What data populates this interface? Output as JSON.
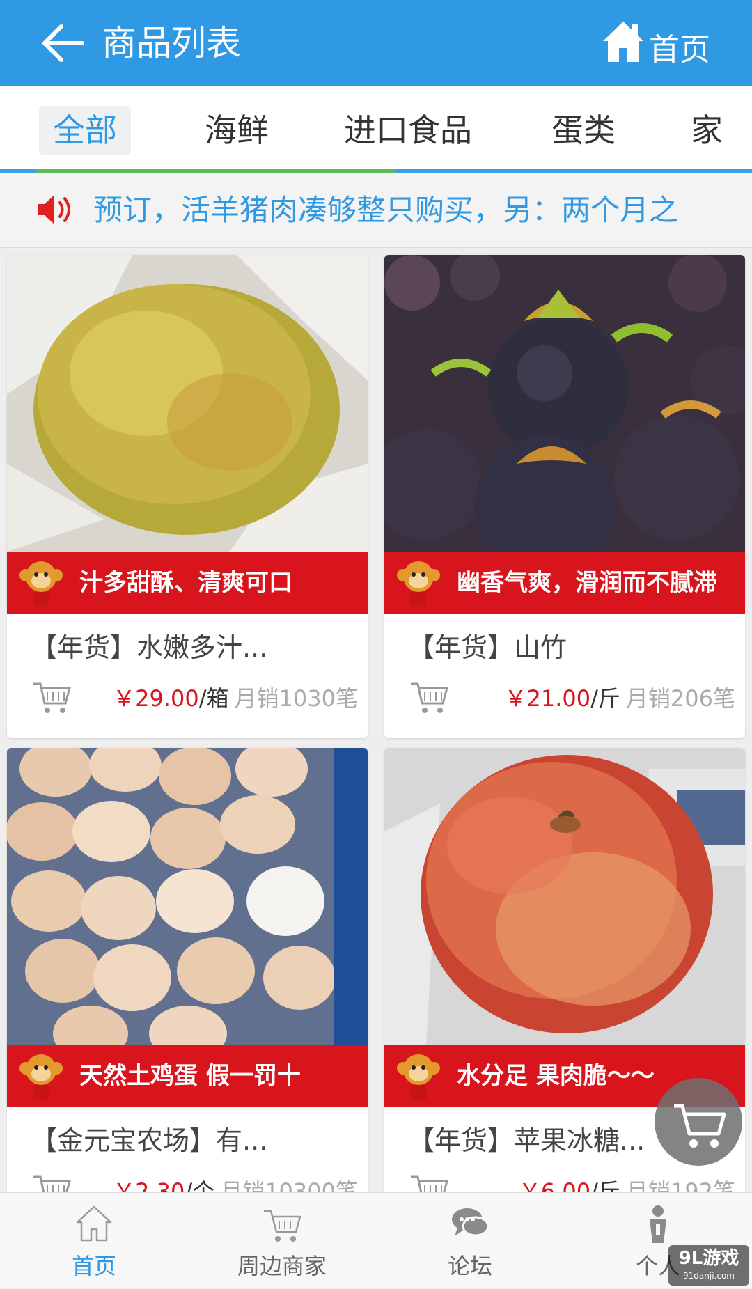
{
  "header": {
    "title": "商品列表",
    "home_label": "首页",
    "bg_color": "#2f9ae3"
  },
  "tabs": [
    {
      "label": "全部",
      "active": true
    },
    {
      "label": "海鲜",
      "active": false
    },
    {
      "label": "进口食品",
      "active": false
    },
    {
      "label": "蛋类",
      "active": false
    },
    {
      "label": "家",
      "active": false
    }
  ],
  "notice": {
    "text": "预订，活羊猪肉凑够整只购买，另：两个月之"
  },
  "products": [
    {
      "slogan": "汁多甜酥、清爽可口",
      "name": "【年货】水嫩多汁...",
      "price": "￥29.00",
      "unit": "/箱",
      "sales": "月销1030笔",
      "image": "pear"
    },
    {
      "slogan": "幽香气爽，滑润而不腻滞",
      "name": "【年货】山竹",
      "price": "￥21.00",
      "unit": "/斤",
      "sales": "月销206笔",
      "image": "mangosteen"
    },
    {
      "slogan": "天然土鸡蛋 假一罚十",
      "name": "【金元宝农场】有...",
      "price": "￥2.30",
      "unit": "/个",
      "sales": "月销10300笔",
      "image": "eggs"
    },
    {
      "slogan": "水分足 果肉脆～～",
      "name": "【年货】苹果冰糖...",
      "price": "￥6.00",
      "unit": "/斤",
      "sales": "月销192笔",
      "image": "apple"
    }
  ],
  "bottom_nav": [
    {
      "label": "首页",
      "icon": "home-icon",
      "active": true
    },
    {
      "label": "周边商家",
      "icon": "cart-icon",
      "active": false
    },
    {
      "label": "论坛",
      "icon": "chat-icon",
      "active": false
    },
    {
      "label": "个人",
      "icon": "person-icon",
      "active": false
    }
  ],
  "watermark": {
    "main": "9L游戏",
    "sub": "91danji.com"
  },
  "colors": {
    "accent": "#2f9ae3",
    "banner": "#d8141c",
    "price": "#d8141c"
  }
}
